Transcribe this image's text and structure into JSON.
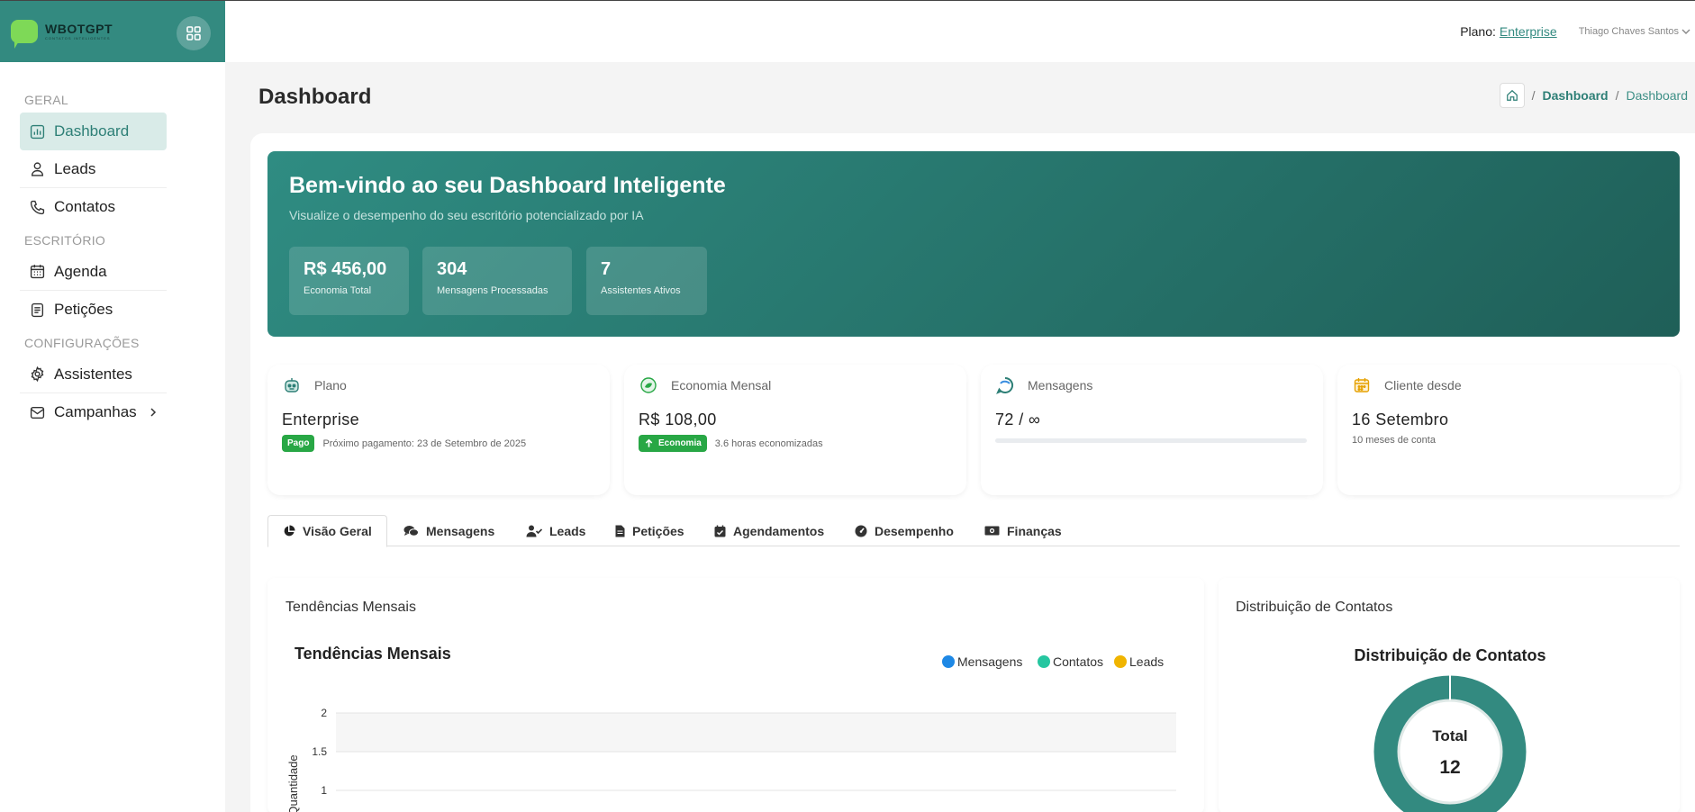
{
  "brand": {
    "name": "WBOTGPT",
    "tagline": "CONTATOS INTELIGENTES"
  },
  "topbar": {
    "plan_label": "Plano:",
    "plan_value": "Enterprise",
    "user_name": "Thiago Chaves Santos"
  },
  "sidebar": {
    "sections": [
      {
        "title": "GERAL",
        "items": [
          {
            "label": "Dashboard",
            "icon": "chart-icon",
            "active": true
          },
          {
            "label": "Leads",
            "icon": "user-icon"
          },
          {
            "label": "Contatos",
            "icon": "phone-icon"
          }
        ]
      },
      {
        "title": "ESCRITÓRIO",
        "items": [
          {
            "label": "Agenda",
            "icon": "calendar-icon"
          },
          {
            "label": "Petições",
            "icon": "document-icon"
          }
        ]
      },
      {
        "title": "CONFIGURAÇÕES",
        "items": [
          {
            "label": "Assistentes",
            "icon": "gear-icon"
          },
          {
            "label": "Campanhas",
            "icon": "mail-icon",
            "has_submenu": true
          }
        ]
      }
    ]
  },
  "page": {
    "title": "Dashboard",
    "breadcrumb": [
      "Dashboard",
      "Dashboard"
    ]
  },
  "hero": {
    "title": "Bem-vindo ao seu Dashboard Inteligente",
    "subtitle": "Visualize o desempenho do seu escritório potencializado por IA",
    "stats": [
      {
        "value": "R$ 456,00",
        "label": "Economia Total"
      },
      {
        "value": "304",
        "label": "Mensagens Processadas"
      },
      {
        "value": "7",
        "label": "Assistentes Ativos"
      }
    ]
  },
  "cards": {
    "plan": {
      "label": "Plano",
      "value": "Enterprise",
      "badge": "Pago",
      "note": "Próximo pagamento: 23 de Setembro de 2025"
    },
    "savings": {
      "label": "Economia Mensal",
      "value": "R$ 108,00",
      "badge": "Economia",
      "note": "3.6 horas economizadas"
    },
    "messages": {
      "label": "Mensagens",
      "value": "72 / ∞",
      "progress": 0
    },
    "client": {
      "label": "Cliente desde",
      "value": "16 Setembro",
      "note": "10 meses de conta"
    }
  },
  "tabs": [
    {
      "label": "Visão Geral",
      "icon": "pie-chart-icon",
      "active": true
    },
    {
      "label": "Mensagens",
      "icon": "comments-icon"
    },
    {
      "label": "Leads",
      "icon": "user-check-icon"
    },
    {
      "label": "Petições",
      "icon": "file-icon"
    },
    {
      "label": "Agendamentos",
      "icon": "calendar-check-icon"
    },
    {
      "label": "Desempenho",
      "icon": "gauge-icon"
    },
    {
      "label": "Finanças",
      "icon": "money-icon"
    }
  ],
  "panels": {
    "trends_title": "Tendências Mensais",
    "distribution_title": "Distribuição de Contatos"
  },
  "chart_data": [
    {
      "type": "line",
      "title": "Tendências Mensais",
      "ylabel": "Quantidade",
      "y_ticks": [
        "2",
        "1.5",
        "1"
      ],
      "ylim": [
        0,
        2
      ],
      "legend_position": "top-right",
      "series": [
        {
          "name": "Mensagens",
          "color": "#1e88e5"
        },
        {
          "name": "Contatos",
          "color": "#26c6a0"
        },
        {
          "name": "Leads",
          "color": "#f0b400"
        }
      ]
    },
    {
      "type": "pie",
      "title": "Distribuição de Contatos",
      "center_label": "Total",
      "center_value": "12",
      "values": [
        12
      ],
      "colors": [
        "#338a80"
      ]
    }
  ]
}
